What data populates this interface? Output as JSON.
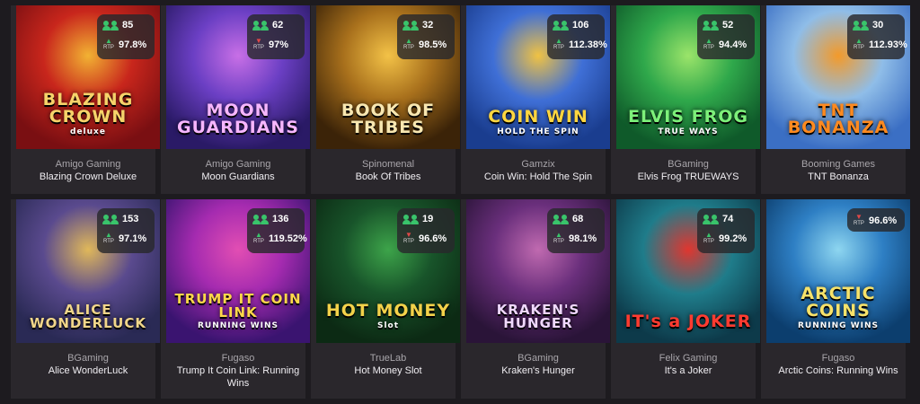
{
  "games": [
    {
      "provider": "Amigo Gaming",
      "name": "Blazing Crown Deluxe",
      "players": "85",
      "rtp": "97.8%",
      "trend": "up",
      "art_title": "BLAZING CROWN",
      "art_sub": "deluxe",
      "colors": [
        "#7a0f12",
        "#c8261c",
        "#f2b233"
      ],
      "title_color": "#f6d36a"
    },
    {
      "provider": "Amigo Gaming",
      "name": "Moon Guardians",
      "players": "62",
      "rtp": "97%",
      "trend": "down",
      "art_title": "MOON GUARDIANS",
      "art_sub": "",
      "colors": [
        "#2a1a66",
        "#6b3fc4",
        "#c86fe6"
      ],
      "title_color": "#f7b6ff"
    },
    {
      "provider": "Spinomenal",
      "name": "Book Of Tribes",
      "players": "32",
      "rtp": "98.5%",
      "trend": "up",
      "art_title": "BOOK OF TRIBES",
      "art_sub": "",
      "colors": [
        "#3b2308",
        "#a8701c",
        "#f3c247"
      ],
      "title_color": "#f8e7b0"
    },
    {
      "provider": "Gamzix",
      "name": "Coin Win: Hold The Spin",
      "players": "106",
      "rtp": "112.38%",
      "trend": "up",
      "art_title": "COIN WIN",
      "art_sub": "HOLD THE SPIN",
      "colors": [
        "#1a3d8f",
        "#3f6fd6",
        "#f0c243"
      ],
      "title_color": "#ffd640"
    },
    {
      "provider": "BGaming",
      "name": "Elvis Frog TRUEWAYS",
      "players": "52",
      "rtp": "94.4%",
      "trend": "up",
      "art_title": "ELVIS FROG",
      "art_sub": "TRUE WAYS",
      "colors": [
        "#0f5a2a",
        "#2fa84b",
        "#9be46a"
      ],
      "title_color": "#7df07a"
    },
    {
      "provider": "Booming Games",
      "name": "TNT Bonanza",
      "players": "30",
      "rtp": "112.93%",
      "trend": "up",
      "art_title": "TNT BONANZA",
      "art_sub": "",
      "colors": [
        "#3b6fc4",
        "#8fbde8",
        "#f39a2a"
      ],
      "title_color": "#ff8a1f"
    },
    {
      "provider": "BGaming",
      "name": "Alice WonderLuck",
      "players": "153",
      "rtp": "97.1%",
      "trend": "up",
      "art_title": "ALICE WONDERLUCK",
      "art_sub": "",
      "colors": [
        "#2a2a55",
        "#5a4a8e",
        "#e0b85a"
      ],
      "title_color": "#f1d68a"
    },
    {
      "provider": "Fugaso",
      "name": "Trump It Coin Link: Running Wins",
      "players": "136",
      "rtp": "119.52%",
      "trend": "up",
      "art_title": "TRUMP IT COIN LINK",
      "art_sub": "RUNNING WINS",
      "colors": [
        "#3a1470",
        "#a52bb0",
        "#e24eb3"
      ],
      "title_color": "#ffd84a"
    },
    {
      "provider": "TrueLab",
      "name": "Hot Money Slot",
      "players": "19",
      "rtp": "96.6%",
      "trend": "down",
      "art_title": "HOT MONEY",
      "art_sub": "Slot",
      "colors": [
        "#0c2a14",
        "#18542a",
        "#3da44a"
      ],
      "title_color": "#f3d24a"
    },
    {
      "provider": "BGaming",
      "name": "Kraken's Hunger",
      "players": "68",
      "rtp": "98.1%",
      "trend": "up",
      "art_title": "KRAKEN'S HUNGER",
      "art_sub": "",
      "colors": [
        "#2a1438",
        "#6a2f7c",
        "#c06ab0"
      ],
      "title_color": "#f0d8ff"
    },
    {
      "provider": "Felix Gaming",
      "name": "It's a Joker",
      "players": "74",
      "rtp": "99.2%",
      "trend": "up",
      "art_title": "IT's a JOKER",
      "art_sub": "",
      "colors": [
        "#0d3a4a",
        "#1f7c8a",
        "#e0362f"
      ],
      "title_color": "#ff3b30"
    },
    {
      "provider": "Fugaso",
      "name": "Arctic Coins: Running Wins",
      "players": "",
      "rtp": "96.6%",
      "trend": "down",
      "art_title": "ARCTIC COINS",
      "art_sub": "RUNNING WINS",
      "colors": [
        "#0c3e6e",
        "#2e7fc4",
        "#8ed6f0"
      ],
      "title_color": "#f7e26a"
    }
  ]
}
